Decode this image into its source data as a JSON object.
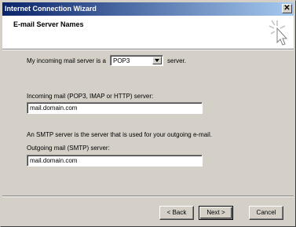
{
  "window": {
    "title": "Internet Connection Wizard",
    "close_glyph": "✕"
  },
  "header": {
    "title": "E-mail Server Names",
    "icon": "wizard-cursor-icon"
  },
  "server_type": {
    "prefix": "My incoming mail server is a",
    "selected": "POP3",
    "suffix": "server."
  },
  "incoming": {
    "label": "Incoming mail (POP3, IMAP or HTTP) server:",
    "value": "mail.domain.com"
  },
  "smtp_note": "An SMTP server is the server that is used for your outgoing e-mail.",
  "outgoing": {
    "label": "Outgoing mail (SMTP) server:",
    "value": "mail.domain.com"
  },
  "buttons": {
    "back": "< Back",
    "next": "Next >",
    "cancel": "Cancel"
  }
}
